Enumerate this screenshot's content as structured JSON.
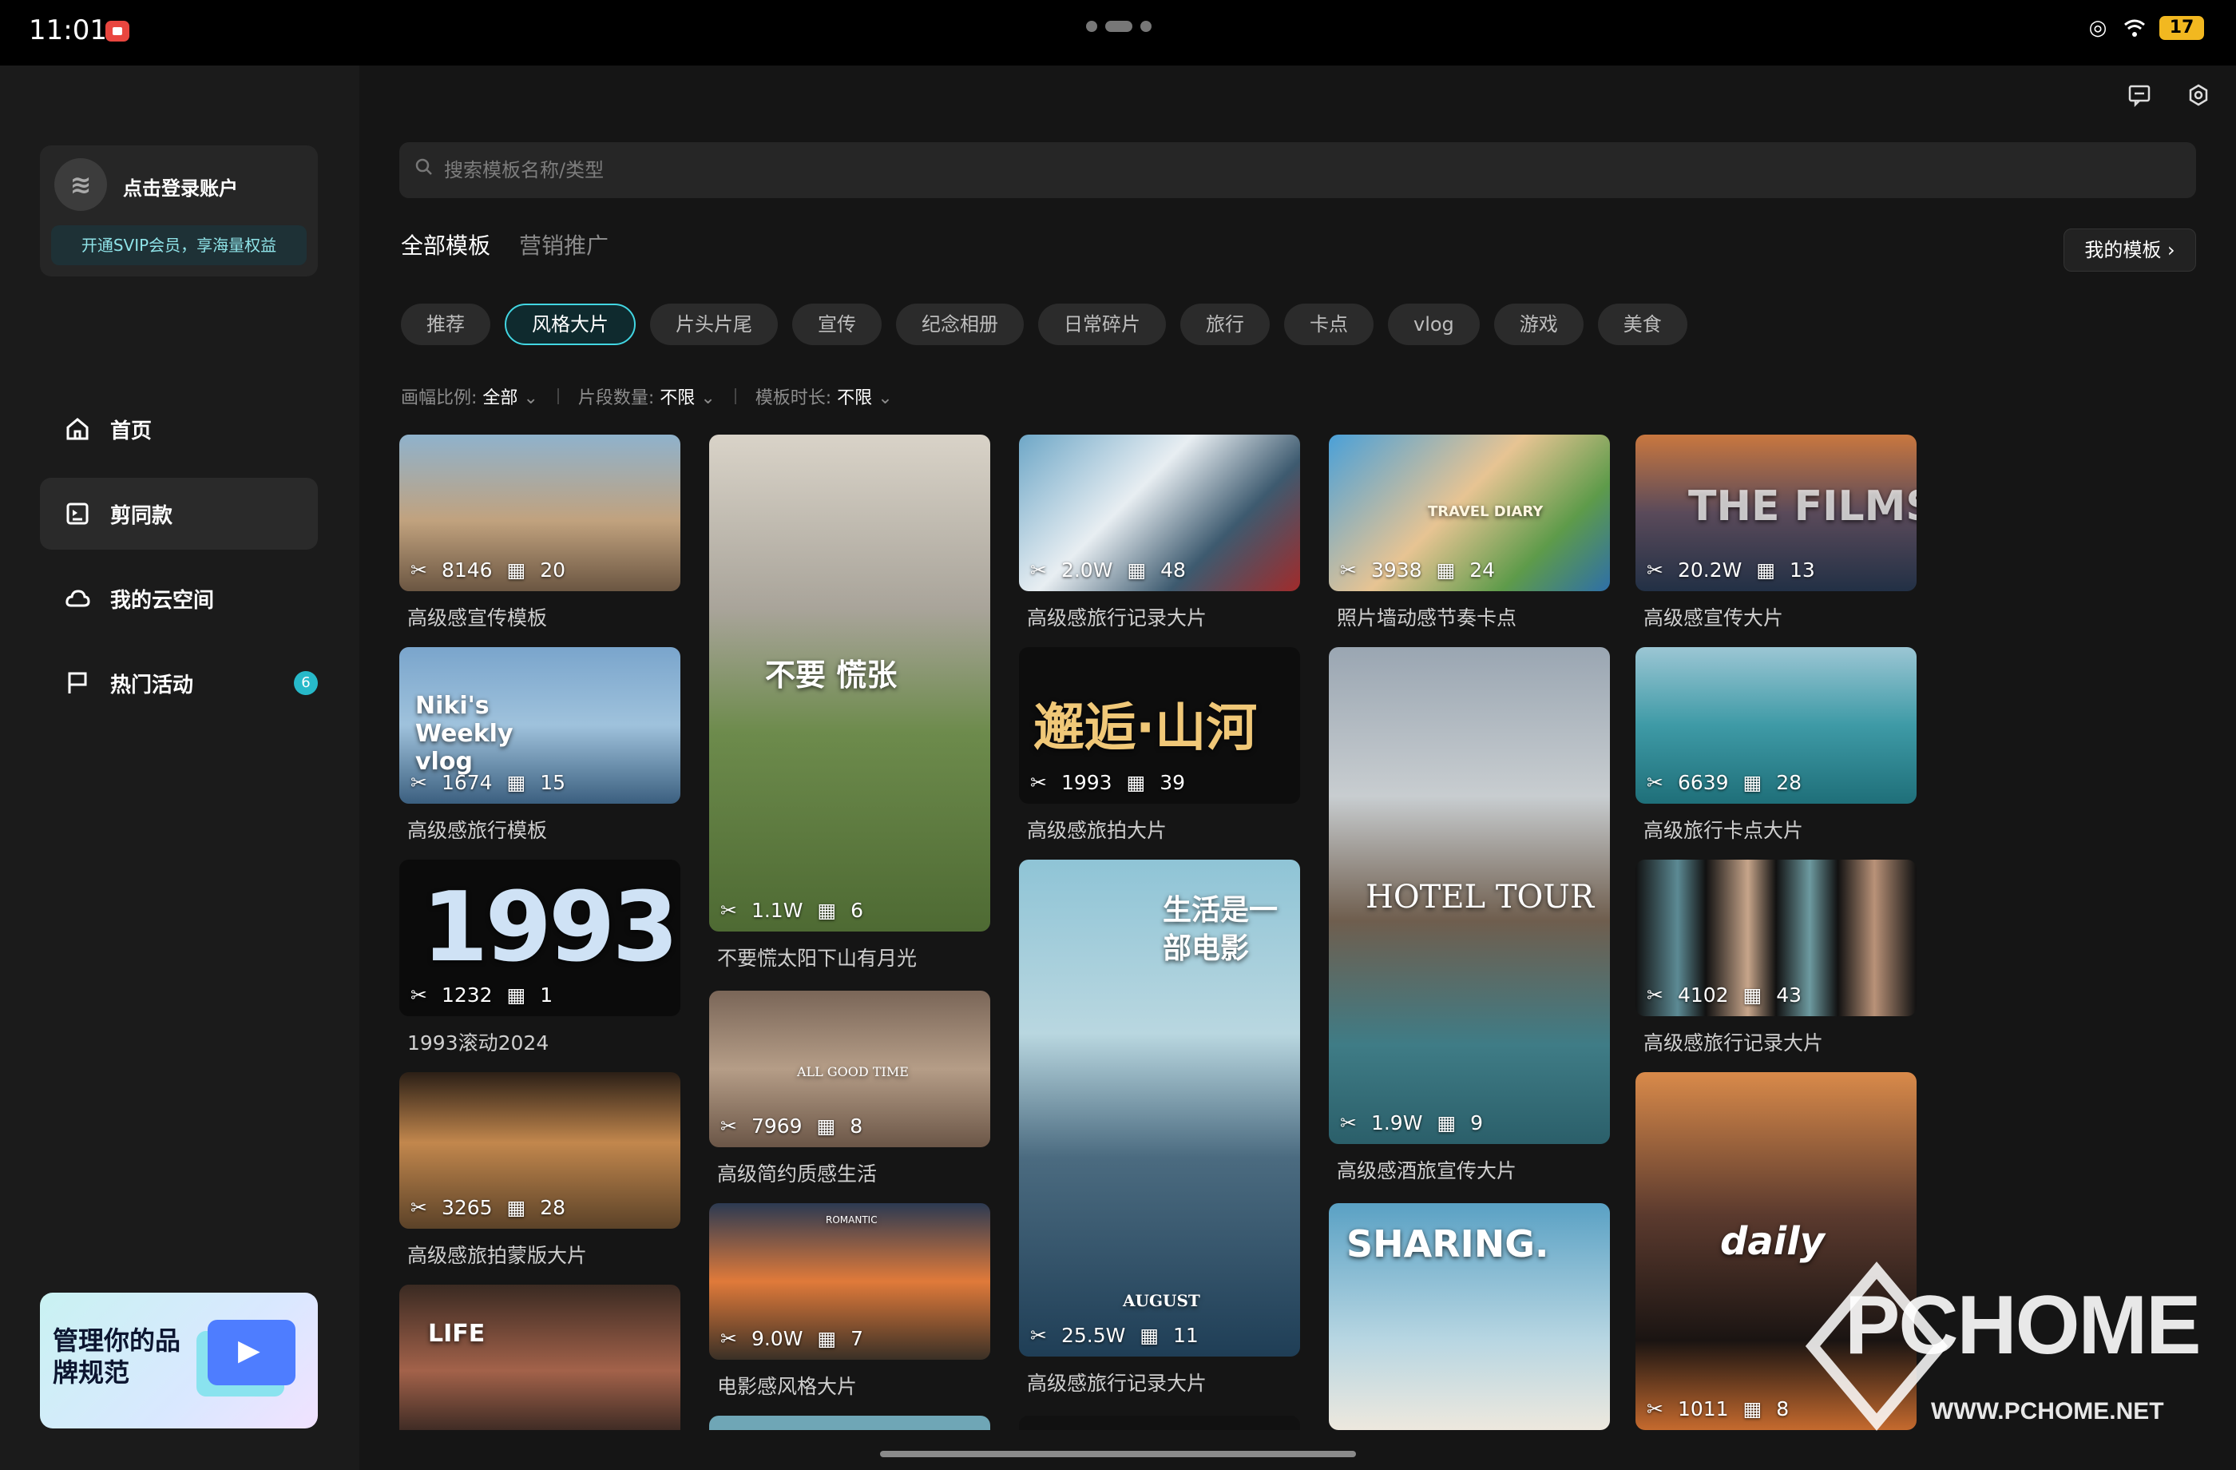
{
  "status_bar": {
    "time": "11:01",
    "battery": "17"
  },
  "sidebar": {
    "login_label": "点击登录账户",
    "vip_label": "开通SVIP会员，享海量权益",
    "nav": [
      {
        "label": "首页",
        "icon": "home-icon"
      },
      {
        "label": "剪同款",
        "icon": "template-icon"
      },
      {
        "label": "我的云空间",
        "icon": "cloud-icon"
      },
      {
        "label": "热门活动",
        "icon": "flag-icon",
        "badge": "6"
      }
    ],
    "banner_title": "管理你的品牌规范"
  },
  "search": {
    "placeholder": "搜索模板名称/类型"
  },
  "tabs": [
    "全部模板",
    "营销推广"
  ],
  "my_templates_label": "我的模板",
  "chips": [
    "推荐",
    "风格大片",
    "片头片尾",
    "宣传",
    "纪念相册",
    "日常碎片",
    "旅行",
    "卡点",
    "vlog",
    "游戏",
    "美食"
  ],
  "active_chip": "风格大片",
  "filters": [
    {
      "label": "画幅比例:",
      "value": "全部"
    },
    {
      "label": "片段数量:",
      "value": "不限"
    },
    {
      "label": "模板时长:",
      "value": "不限"
    }
  ],
  "cards": [
    {
      "title": "高级感宣传模板",
      "uses": "8146",
      "clips": "20"
    },
    {
      "title": "高级感旅行模板",
      "uses": "1674",
      "clips": "15",
      "overlay": "Niki's Weekly vlog"
    },
    {
      "title": "1993滚动2024",
      "uses": "1232",
      "clips": "1",
      "overlay": "1993"
    },
    {
      "title": "高级感旅拍蒙版大片",
      "uses": "3265",
      "clips": "28"
    },
    {
      "title": "",
      "uses": "",
      "clips": "",
      "overlay": "LIFE"
    },
    {
      "title": "不要慌太阳下山有月光",
      "uses": "1.1W",
      "clips": "6",
      "overlay": "不要 慌张"
    },
    {
      "title": "高级简约质感生活",
      "uses": "7969",
      "clips": "8",
      "overlay": "ALL GOOD TIME"
    },
    {
      "title": "电影感风格大片",
      "uses": "9.0W",
      "clips": "7",
      "overlay": "ROMANTIC"
    },
    {
      "title": "高级感旅行记录大片",
      "uses": "2.0W",
      "clips": "48"
    },
    {
      "title": "高级感旅拍大片",
      "uses": "1993",
      "clips": "39",
      "overlay": "邂逅·山河"
    },
    {
      "title": "高级感旅行记录大片",
      "uses": "25.5W",
      "clips": "11",
      "overlay": "生活是一部电影",
      "overlay2": "AUGUST"
    },
    {
      "title": "照片墙动感节奏卡点",
      "uses": "3938",
      "clips": "24",
      "overlay": "TRAVEL DIARY"
    },
    {
      "title": "高级感酒旅宣传大片",
      "uses": "1.9W",
      "clips": "9",
      "overlay": "HOTEL TOUR"
    },
    {
      "title": "",
      "uses": "",
      "clips": "",
      "overlay": "SHARING."
    },
    {
      "title": "高级感宣传大片",
      "uses": "20.2W",
      "clips": "13",
      "overlay": "THE FILMS"
    },
    {
      "title": "高级旅行卡点大片",
      "uses": "6639",
      "clips": "28"
    },
    {
      "title": "高级感旅行记录大片",
      "uses": "4102",
      "clips": "43"
    },
    {
      "title": "",
      "uses": "1011",
      "clips": "8",
      "overlay": "daily"
    }
  ],
  "watermark": {
    "logo": "PCHOME",
    "url": "WWW.PCHOME.NET"
  }
}
